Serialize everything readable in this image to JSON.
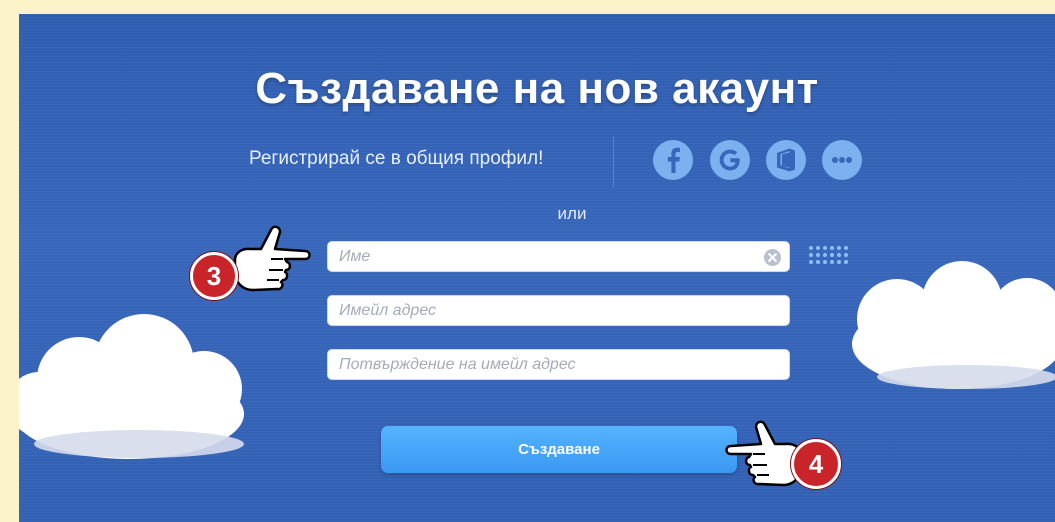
{
  "page": {
    "title": "Създаване на нов акаунт",
    "subtitle": "Регистрирай се в общия профил!",
    "or_text": "или"
  },
  "social_logins": [
    {
      "name": "facebook-icon",
      "glyph": "f"
    },
    {
      "name": "google-icon",
      "glyph": "G"
    },
    {
      "name": "office-icon",
      "glyph": ""
    },
    {
      "name": "more-icon",
      "glyph": ""
    }
  ],
  "form": {
    "name_placeholder": "Име",
    "email_placeholder": "Имейл адрес",
    "confirm_email_placeholder": "Потвърждение на имейл адрес",
    "submit_label": "Създаване"
  },
  "annotations": {
    "step_3": "3",
    "step_4": "4"
  },
  "colors": {
    "page_background": "#fdf3c9",
    "panel_blue": "#3866bb",
    "social_icon": "#7cb0ef",
    "button_blue": "#3a98f2",
    "badge_red": "#c8242a"
  }
}
